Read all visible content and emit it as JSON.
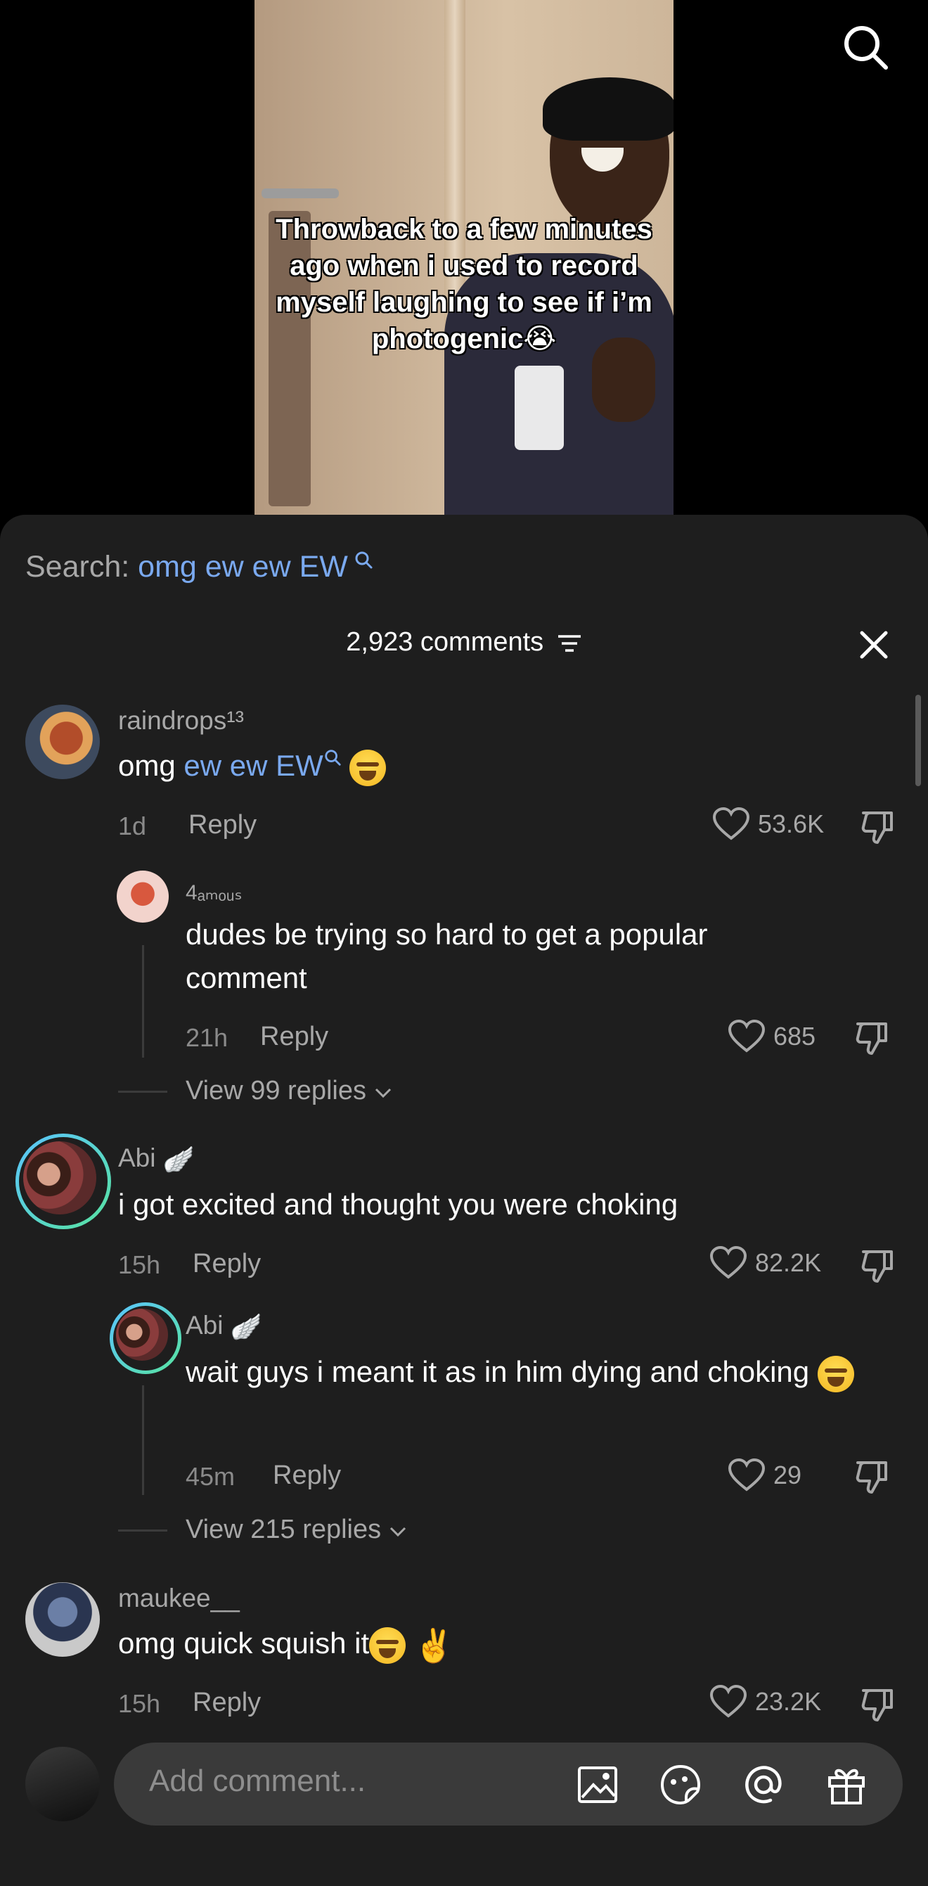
{
  "video": {
    "caption": "Throwback to a few minutes ago when i used to record myself laughing to see if i’m photogenic😭"
  },
  "icons": {
    "search": "search-icon",
    "close": "close-icon",
    "sort": "filter-lines-icon",
    "like": "heart-icon",
    "dislike": "thumbs-down-icon",
    "chevron": "chevron-down-icon",
    "image": "image-icon",
    "sticker": "sticker-icon",
    "mention": "at-icon",
    "gift": "gift-icon"
  },
  "colors": {
    "accent": "#7aa9ef",
    "sheet": "#1e1e1e",
    "muted": "#a8a8a8"
  },
  "search": {
    "label": "Search:",
    "query": "omg ew ew EW"
  },
  "header": {
    "count_label": "2,923 comments"
  },
  "comments": [
    {
      "username": "raindrops¹³",
      "text_prefix": "omg ",
      "text_link": "ew ew EW",
      "time": "1d",
      "reply_label": "Reply",
      "likes": "53.6K",
      "replies": [
        {
          "username": "4ₐₘₒᵤₛ",
          "text": "dudes be trying so hard to get a popular comment",
          "time": "21h",
          "reply_label": "Reply",
          "likes": "685"
        }
      ],
      "view_replies": "View 99 replies"
    },
    {
      "username": "Abi",
      "text": "i got excited and thought you were choking",
      "time": "15h",
      "reply_label": "Reply",
      "likes": "82.2K",
      "replies": [
        {
          "username": "Abi",
          "text": "wait guys i meant it as in him dying and choking",
          "time": "45m",
          "reply_label": "Reply",
          "likes": "29"
        }
      ],
      "view_replies": "View 215 replies"
    },
    {
      "username": "maukee__",
      "text": "omg quick squish it",
      "time": "15h",
      "reply_label": "Reply",
      "likes": "23.2K"
    }
  ],
  "composer": {
    "placeholder": "Add comment..."
  }
}
